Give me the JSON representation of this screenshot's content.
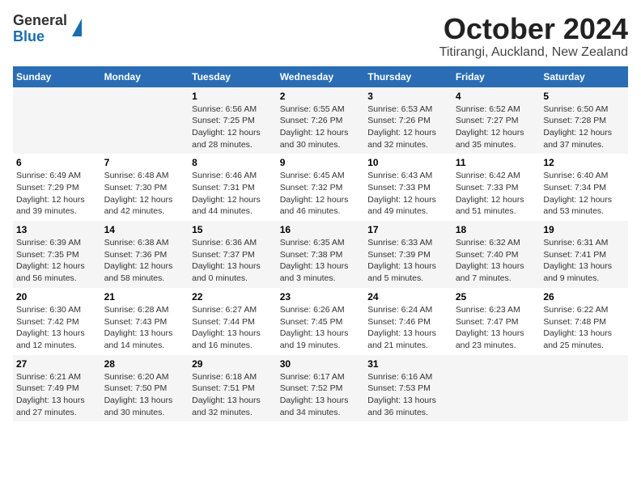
{
  "logo": {
    "general": "General",
    "blue": "Blue"
  },
  "title": "October 2024",
  "location": "Titirangi, Auckland, New Zealand",
  "weekdays": [
    "Sunday",
    "Monday",
    "Tuesday",
    "Wednesday",
    "Thursday",
    "Friday",
    "Saturday"
  ],
  "weeks": [
    [
      {
        "day": "",
        "info": ""
      },
      {
        "day": "",
        "info": ""
      },
      {
        "day": "1",
        "info": "Sunrise: 6:56 AM\nSunset: 7:25 PM\nDaylight: 12 hours\nand 28 minutes."
      },
      {
        "day": "2",
        "info": "Sunrise: 6:55 AM\nSunset: 7:26 PM\nDaylight: 12 hours\nand 30 minutes."
      },
      {
        "day": "3",
        "info": "Sunrise: 6:53 AM\nSunset: 7:26 PM\nDaylight: 12 hours\nand 32 minutes."
      },
      {
        "day": "4",
        "info": "Sunrise: 6:52 AM\nSunset: 7:27 PM\nDaylight: 12 hours\nand 35 minutes."
      },
      {
        "day": "5",
        "info": "Sunrise: 6:50 AM\nSunset: 7:28 PM\nDaylight: 12 hours\nand 37 minutes."
      }
    ],
    [
      {
        "day": "6",
        "info": "Sunrise: 6:49 AM\nSunset: 7:29 PM\nDaylight: 12 hours\nand 39 minutes."
      },
      {
        "day": "7",
        "info": "Sunrise: 6:48 AM\nSunset: 7:30 PM\nDaylight: 12 hours\nand 42 minutes."
      },
      {
        "day": "8",
        "info": "Sunrise: 6:46 AM\nSunset: 7:31 PM\nDaylight: 12 hours\nand 44 minutes."
      },
      {
        "day": "9",
        "info": "Sunrise: 6:45 AM\nSunset: 7:32 PM\nDaylight: 12 hours\nand 46 minutes."
      },
      {
        "day": "10",
        "info": "Sunrise: 6:43 AM\nSunset: 7:33 PM\nDaylight: 12 hours\nand 49 minutes."
      },
      {
        "day": "11",
        "info": "Sunrise: 6:42 AM\nSunset: 7:33 PM\nDaylight: 12 hours\nand 51 minutes."
      },
      {
        "day": "12",
        "info": "Sunrise: 6:40 AM\nSunset: 7:34 PM\nDaylight: 12 hours\nand 53 minutes."
      }
    ],
    [
      {
        "day": "13",
        "info": "Sunrise: 6:39 AM\nSunset: 7:35 PM\nDaylight: 12 hours\nand 56 minutes."
      },
      {
        "day": "14",
        "info": "Sunrise: 6:38 AM\nSunset: 7:36 PM\nDaylight: 12 hours\nand 58 minutes."
      },
      {
        "day": "15",
        "info": "Sunrise: 6:36 AM\nSunset: 7:37 PM\nDaylight: 13 hours\nand 0 minutes."
      },
      {
        "day": "16",
        "info": "Sunrise: 6:35 AM\nSunset: 7:38 PM\nDaylight: 13 hours\nand 3 minutes."
      },
      {
        "day": "17",
        "info": "Sunrise: 6:33 AM\nSunset: 7:39 PM\nDaylight: 13 hours\nand 5 minutes."
      },
      {
        "day": "18",
        "info": "Sunrise: 6:32 AM\nSunset: 7:40 PM\nDaylight: 13 hours\nand 7 minutes."
      },
      {
        "day": "19",
        "info": "Sunrise: 6:31 AM\nSunset: 7:41 PM\nDaylight: 13 hours\nand 9 minutes."
      }
    ],
    [
      {
        "day": "20",
        "info": "Sunrise: 6:30 AM\nSunset: 7:42 PM\nDaylight: 13 hours\nand 12 minutes."
      },
      {
        "day": "21",
        "info": "Sunrise: 6:28 AM\nSunset: 7:43 PM\nDaylight: 13 hours\nand 14 minutes."
      },
      {
        "day": "22",
        "info": "Sunrise: 6:27 AM\nSunset: 7:44 PM\nDaylight: 13 hours\nand 16 minutes."
      },
      {
        "day": "23",
        "info": "Sunrise: 6:26 AM\nSunset: 7:45 PM\nDaylight: 13 hours\nand 19 minutes."
      },
      {
        "day": "24",
        "info": "Sunrise: 6:24 AM\nSunset: 7:46 PM\nDaylight: 13 hours\nand 21 minutes."
      },
      {
        "day": "25",
        "info": "Sunrise: 6:23 AM\nSunset: 7:47 PM\nDaylight: 13 hours\nand 23 minutes."
      },
      {
        "day": "26",
        "info": "Sunrise: 6:22 AM\nSunset: 7:48 PM\nDaylight: 13 hours\nand 25 minutes."
      }
    ],
    [
      {
        "day": "27",
        "info": "Sunrise: 6:21 AM\nSunset: 7:49 PM\nDaylight: 13 hours\nand 27 minutes."
      },
      {
        "day": "28",
        "info": "Sunrise: 6:20 AM\nSunset: 7:50 PM\nDaylight: 13 hours\nand 30 minutes."
      },
      {
        "day": "29",
        "info": "Sunrise: 6:18 AM\nSunset: 7:51 PM\nDaylight: 13 hours\nand 32 minutes."
      },
      {
        "day": "30",
        "info": "Sunrise: 6:17 AM\nSunset: 7:52 PM\nDaylight: 13 hours\nand 34 minutes."
      },
      {
        "day": "31",
        "info": "Sunrise: 6:16 AM\nSunset: 7:53 PM\nDaylight: 13 hours\nand 36 minutes."
      },
      {
        "day": "",
        "info": ""
      },
      {
        "day": "",
        "info": ""
      }
    ]
  ]
}
